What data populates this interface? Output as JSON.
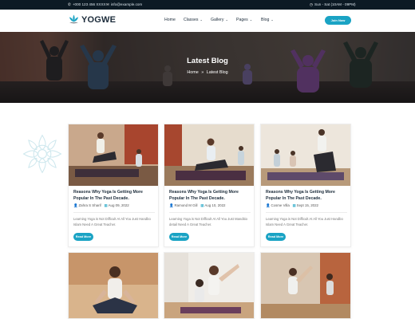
{
  "topbar": {
    "phone": "+000 123 456 XXXX",
    "email": "info@example.com",
    "hours": "Sun - Sat (10AM - 09PM)"
  },
  "brand": {
    "name": "YOGWE"
  },
  "menu": {
    "items": [
      {
        "label": "Home"
      },
      {
        "label": "Classes"
      },
      {
        "label": "Gallery"
      },
      {
        "label": "Pages"
      },
      {
        "label": "Blog"
      }
    ],
    "join_label": "Join Now"
  },
  "hero": {
    "title": "Latest Blog",
    "crumb_home": "Home",
    "crumb_sep": "»",
    "crumb_current": "Latest Blog"
  },
  "colors": {
    "accent": "#1aa3c4",
    "dark": "#0c1a24",
    "heading": "#1b2b3a"
  },
  "posts": [
    {
      "title": "Reasons Why Yoga Is Getting More Popular In The Past Decade.",
      "author": "Zahra S Sharif",
      "date": "Aug 09, 2022",
      "excerpt": "Learning Yoga is Not Difficult At All You Just Handbo Islam Need A Great Teacher.",
      "button": "Read More"
    },
    {
      "title": "Reasons Why Yoga Is Getting More Popular In The Past Decade.",
      "author": "Ramond M Gill",
      "date": "Aug 10, 2022",
      "excerpt": "Learning Yoga is Not Difficult At All You Just Manditio detail Need A Great Teacher.",
      "button": "Read More"
    },
    {
      "title": "Reasons Why Yoga Is Getting More Popular In The Past Decade.",
      "author": "Cosme Villa",
      "date": "Sept 15, 2022",
      "excerpt": "Learning Yoga is Not Difficult At All You Just Handbo Islam Need A Great Teacher.",
      "button": "Read More"
    }
  ]
}
